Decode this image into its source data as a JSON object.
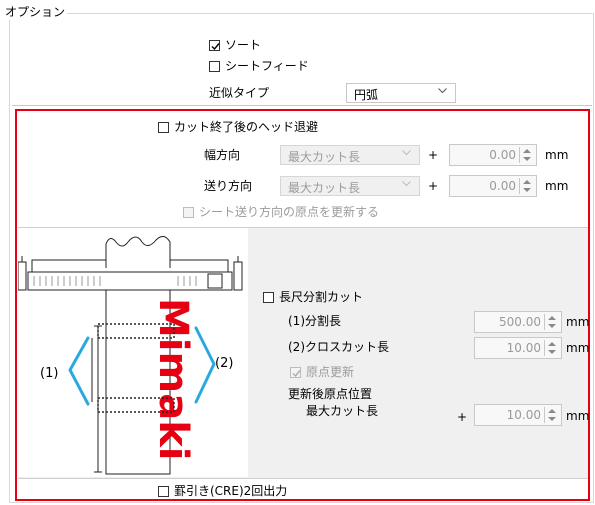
{
  "options": {
    "title": "オプション",
    "sort_label": "ソート",
    "sort_checked": true,
    "sheet_feed_label": "シートフィード",
    "sheet_feed_checked": false,
    "approx_type_label": "近似タイプ",
    "approx_type_value": "円弧"
  },
  "head_retract": {
    "checkbox_label": "カット終了後のヘッド退避",
    "width_label": "幅方向",
    "width_select": "最大カット長",
    "width_plus": "+",
    "width_value": "0.00",
    "width_unit": "mm",
    "feed_label": "送り方向",
    "feed_select": "最大カット長",
    "feed_plus": "+",
    "feed_value": "0.00",
    "feed_unit": "mm",
    "update_origin_label": "シート送り方向の原点を更新する"
  },
  "long_cut": {
    "checkbox_label": "長尺分割カット",
    "split_len_label": "(1)分割長",
    "split_len_value": "500.00",
    "split_len_unit": "mm",
    "cross_cut_label": "(2)クロスカット長",
    "cross_cut_value": "10.00",
    "cross_cut_unit": "mm",
    "origin_update_label": "原点更新",
    "origin_update_checked": true,
    "after_update_label": "更新後原点位置",
    "max_cut_label": "最大カット長",
    "plus": "+",
    "after_value": "10.00",
    "after_unit": "mm"
  },
  "diagram": {
    "label_1": "(1)",
    "label_2": "(2)",
    "brand": "Mimaki"
  },
  "rule_output": {
    "checkbox_label": "罫引き(CRE)2回出力"
  },
  "colors": {
    "highlight_red": "#e60012",
    "diagram_blue": "#29a9e0",
    "brand_red": "#e60012"
  }
}
